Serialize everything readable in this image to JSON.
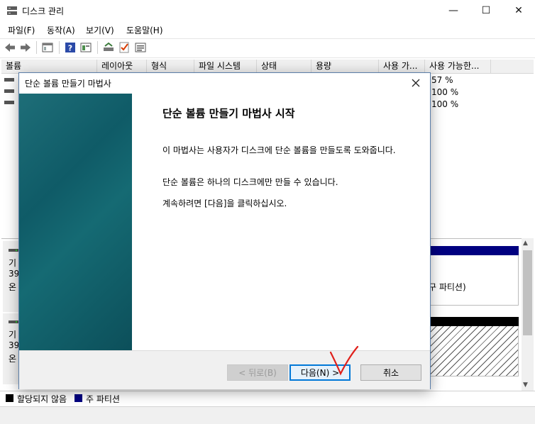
{
  "window": {
    "title": "디스크 관리",
    "controls": {
      "minimize": "—",
      "maximize": "☐",
      "close": "✕"
    }
  },
  "menu": [
    "파일(F)",
    "동작(A)",
    "보기(V)",
    "도움말(H)"
  ],
  "toolbar": {
    "icons": [
      "back-arrow-icon",
      "forward-arrow-icon",
      "console-icon",
      "help-icon",
      "properties-icon",
      "rescan-icon",
      "check-icon",
      "list-icon"
    ]
  },
  "volume_table": {
    "columns": [
      "볼륨",
      "레이아웃",
      "형식",
      "파일 시스템",
      "상태",
      "용량",
      "사용 가...",
      "사용 가능한..."
    ],
    "rows": [
      {
        "percent_free": "57 %"
      },
      {
        "percent_free": "100 %"
      },
      {
        "percent_free": "100 %"
      }
    ]
  },
  "disk_pane": {
    "disks": [
      {
        "line1": "기",
        "line2": "39",
        "line3": "온"
      },
      {
        "line1": "기",
        "line2": "39",
        "line3": "온"
      }
    ],
    "partition_label_fragment": "구 파티션)"
  },
  "legend": {
    "items": [
      {
        "label": "할당되지 않음",
        "color": "#000000"
      },
      {
        "label": "주 파티션",
        "color": "#000080"
      }
    ]
  },
  "dialog": {
    "title": "단순 볼륨 만들기 마법사",
    "heading": "단순 볼륨 만들기 마법사 시작",
    "paragraphs": [
      "이 마법사는 사용자가 디스크에 단순 볼륨을 만들도록 도와줍니다.",
      "단순 볼륨은 하나의 디스크에만 만들 수 있습니다.",
      "계속하려면 [다음]을 클릭하십시오."
    ],
    "buttons": {
      "back": "< 뒤로(B)",
      "next": "다음(N) >",
      "cancel": "취소"
    }
  },
  "colors": {
    "accent": "#0078d7",
    "banner": "#0f5b67",
    "annotation": "#e0201b"
  }
}
